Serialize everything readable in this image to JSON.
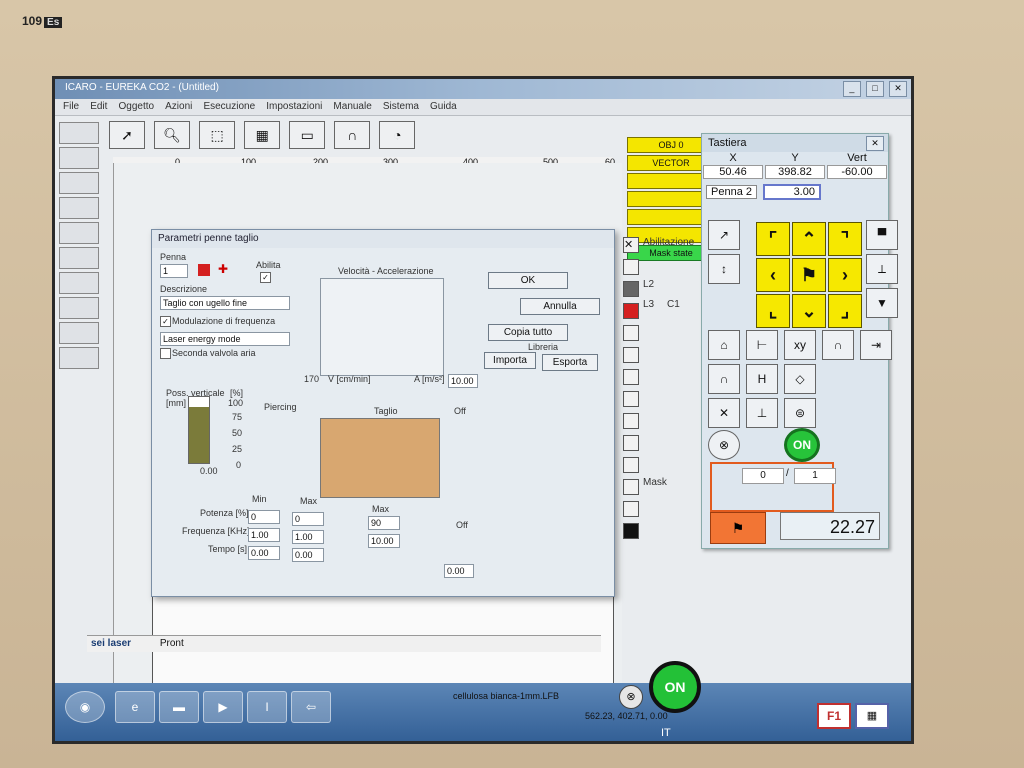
{
  "monitor": {
    "model": "109",
    "model_tag": "Es"
  },
  "app": {
    "title": "ICARO - EUREKA CO2 - (Untitled)"
  },
  "menu": [
    "File",
    "Edit",
    "Oggetto",
    "Azioni",
    "Esecuzione",
    "Impostazioni",
    "Manuale",
    "Sistema",
    "Guida"
  ],
  "ruler": [
    "0",
    "100",
    "200",
    "300",
    "400",
    "500",
    "60"
  ],
  "obj_buttons": [
    "OBJ 0",
    "VECTOR",
    "",
    "",
    "",
    "",
    "Mask state"
  ],
  "layers": {
    "abilitazione": "Abilitazione",
    "l2": "L2",
    "l3": "L3",
    "c1": "C1",
    "mask": "Mask"
  },
  "tastiera": {
    "title": "Tastiera",
    "x_label": "X",
    "y_label": "Y",
    "vert_label": "Vert",
    "x": "50.46",
    "y": "398.82",
    "vert": "-60.00",
    "pen": "Penna 2",
    "pen_value": "3.00",
    "on_label": "ON",
    "counter_left": "0",
    "counter_sep": "/",
    "counter_right": "1",
    "time": "22.27"
  },
  "dialog": {
    "title": "Parametri penne taglio",
    "penna_label": "Penna",
    "penna_value": "1",
    "abilita_label": "Abilita",
    "descrizione_label": "Descrizione",
    "descrizione_value": "Taglio con ugello fine",
    "modulazione": "Modulazione di frequenza",
    "laser_mode": "Laser energy mode",
    "seconda": "Seconda valvola aria",
    "velocita": "Velocità - Accelerazione",
    "v_value": "170",
    "v_unit": "V [cm/min]",
    "a_unit": "A [m/s²]",
    "a_value": "10.00",
    "ok": "OK",
    "annulla": "Annulla",
    "copia": "Copia tutto",
    "libreria": "Libreria",
    "importa": "Importa",
    "esporta": "Esporta",
    "poss_label": "Poss. verticale [mm]",
    "pct_label": "[%]",
    "scale": [
      "100",
      "75",
      "50",
      "25",
      "0"
    ],
    "poss_value": "0.00",
    "poss_fill": 0.85,
    "piercing": "Piercing",
    "taglio": "Taglio",
    "off": "Off",
    "min": "Min",
    "max": "Max",
    "max2": "Max",
    "potenza_label": "Potenza [%]",
    "frequenza_label": "Frequenza [KHz]",
    "tempo_label": "Tempo [s]",
    "potenza_min": "0",
    "potenza_max": "0",
    "potenza_taglio": "90",
    "frequenza_min": "1.00",
    "frequenza_max": "1.00",
    "frequenza_taglio": "10.00",
    "tempo_min": "0.00",
    "tempo_max": "0.00",
    "off_value": "Off",
    "off_num": "0.00"
  },
  "statusbar": {
    "logo": "sei laser",
    "prompt": "Pront",
    "material": "cellulosa bianca-1mm.LFB",
    "coords": "562.23, 402.71, 0.00"
  },
  "bottom_on": "ON",
  "taskbar": {
    "lang": "IT"
  }
}
